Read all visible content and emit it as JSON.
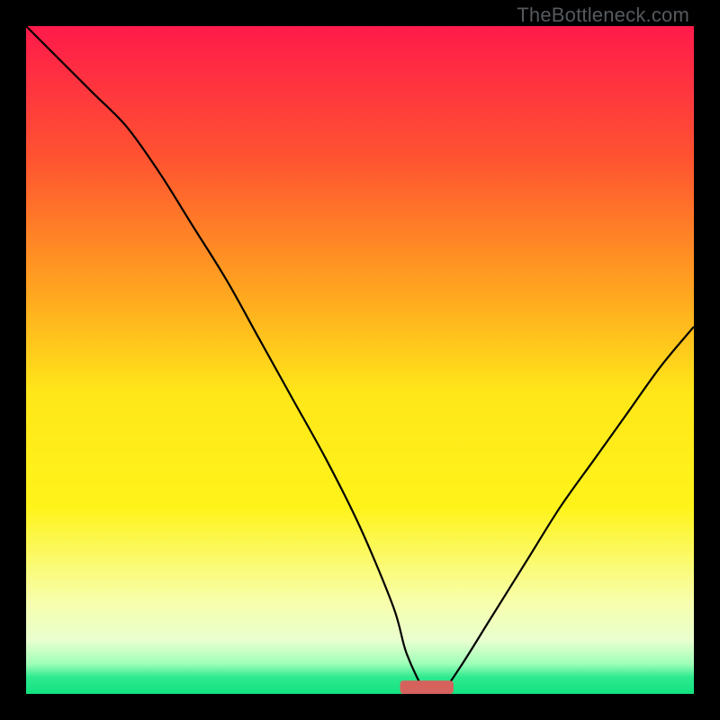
{
  "watermark": "TheBottleneck.com",
  "chart_data": {
    "type": "line",
    "title": "",
    "xlabel": "",
    "ylabel": "",
    "xlim": [
      0,
      100
    ],
    "ylim": [
      0,
      100
    ],
    "grid": false,
    "gradient_stops": [
      {
        "offset": 0.0,
        "color": "#ff1a4b"
      },
      {
        "offset": 0.2,
        "color": "#ff5430"
      },
      {
        "offset": 0.4,
        "color": "#ffa61f"
      },
      {
        "offset": 0.55,
        "color": "#ffe719"
      },
      {
        "offset": 0.72,
        "color": "#fff31a"
      },
      {
        "offset": 0.86,
        "color": "#f8ffaa"
      },
      {
        "offset": 0.92,
        "color": "#e9ffcf"
      },
      {
        "offset": 0.955,
        "color": "#9effb8"
      },
      {
        "offset": 0.975,
        "color": "#2fe98f"
      },
      {
        "offset": 1.0,
        "color": "#12e27f"
      }
    ],
    "series": [
      {
        "name": "bottleneck-curve",
        "color": "#000000",
        "x": [
          0,
          5,
          10,
          15,
          20,
          25,
          30,
          35,
          40,
          45,
          50,
          55,
          57,
          60,
          62,
          65,
          70,
          75,
          80,
          85,
          90,
          95,
          100
        ],
        "y": [
          100,
          95,
          90,
          85,
          78,
          70,
          62,
          53,
          44,
          35,
          25,
          13,
          6,
          0,
          0,
          4,
          12,
          20,
          28,
          35,
          42,
          49,
          55
        ]
      }
    ],
    "marker": {
      "name": "optimal-marker",
      "color": "#d6625d",
      "x": 60,
      "width": 8,
      "y": 0,
      "height": 2
    }
  }
}
